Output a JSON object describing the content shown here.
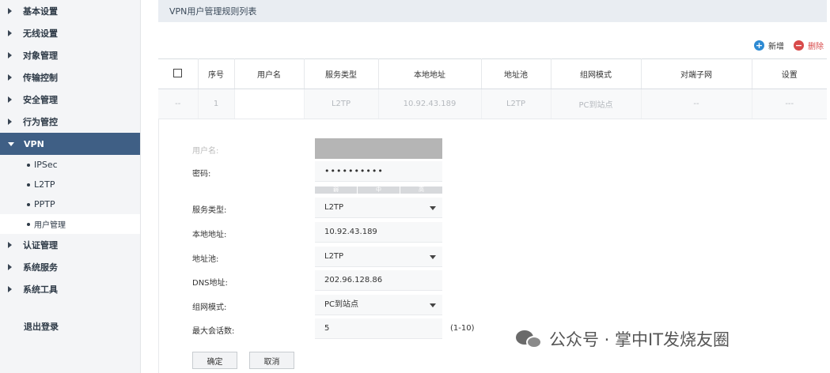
{
  "sidebar": {
    "items": [
      {
        "label": "基本设置"
      },
      {
        "label": "无线设置"
      },
      {
        "label": "对象管理"
      },
      {
        "label": "传输控制"
      },
      {
        "label": "安全管理"
      },
      {
        "label": "行为管控"
      },
      {
        "label": "VPN"
      }
    ],
    "vpn_subitems": [
      {
        "label": "IPSec"
      },
      {
        "label": "L2TP"
      },
      {
        "label": "PPTP"
      },
      {
        "label": "用户管理"
      }
    ],
    "items_after": [
      {
        "label": "认证管理"
      },
      {
        "label": "系统服务"
      },
      {
        "label": "系统工具"
      }
    ],
    "logout": "退出登录"
  },
  "main": {
    "header_title": "VPN用户管理规则列表",
    "add_label": "新增",
    "delete_label": "删除",
    "columns": [
      "序号",
      "用户名",
      "服务类型",
      "本地地址",
      "地址池",
      "组网模式",
      "对端子网",
      "设置"
    ],
    "row": {
      "check": "--",
      "index": "1",
      "username": "",
      "service_type": "L2TP",
      "local_address": "10.92.43.189",
      "address_pool": "L2TP",
      "network_mode": "PC到站点",
      "peer_subnet": "--",
      "settings": "---"
    }
  },
  "form": {
    "username_label": "用户名:",
    "password_label": "密码:",
    "password_value": "••••••••••",
    "strength": [
      "弱",
      "中",
      "高"
    ],
    "service_type_label": "服务类型:",
    "service_type_value": "L2TP",
    "local_address_label": "本地地址:",
    "local_address_value": "10.92.43.189",
    "address_pool_label": "地址池:",
    "address_pool_value": "L2TP",
    "dns_label": "DNS地址:",
    "dns_value": "202.96.128.86",
    "network_mode_label": "组网模式:",
    "network_mode_value": "PC到站点",
    "max_sessions_label": "最大会话数:",
    "max_sessions_value": "5",
    "max_sessions_hint": "(1-10)",
    "ok_label": "确定",
    "cancel_label": "取消"
  },
  "watermark": "公众号 · 掌中IT发烧友圈"
}
